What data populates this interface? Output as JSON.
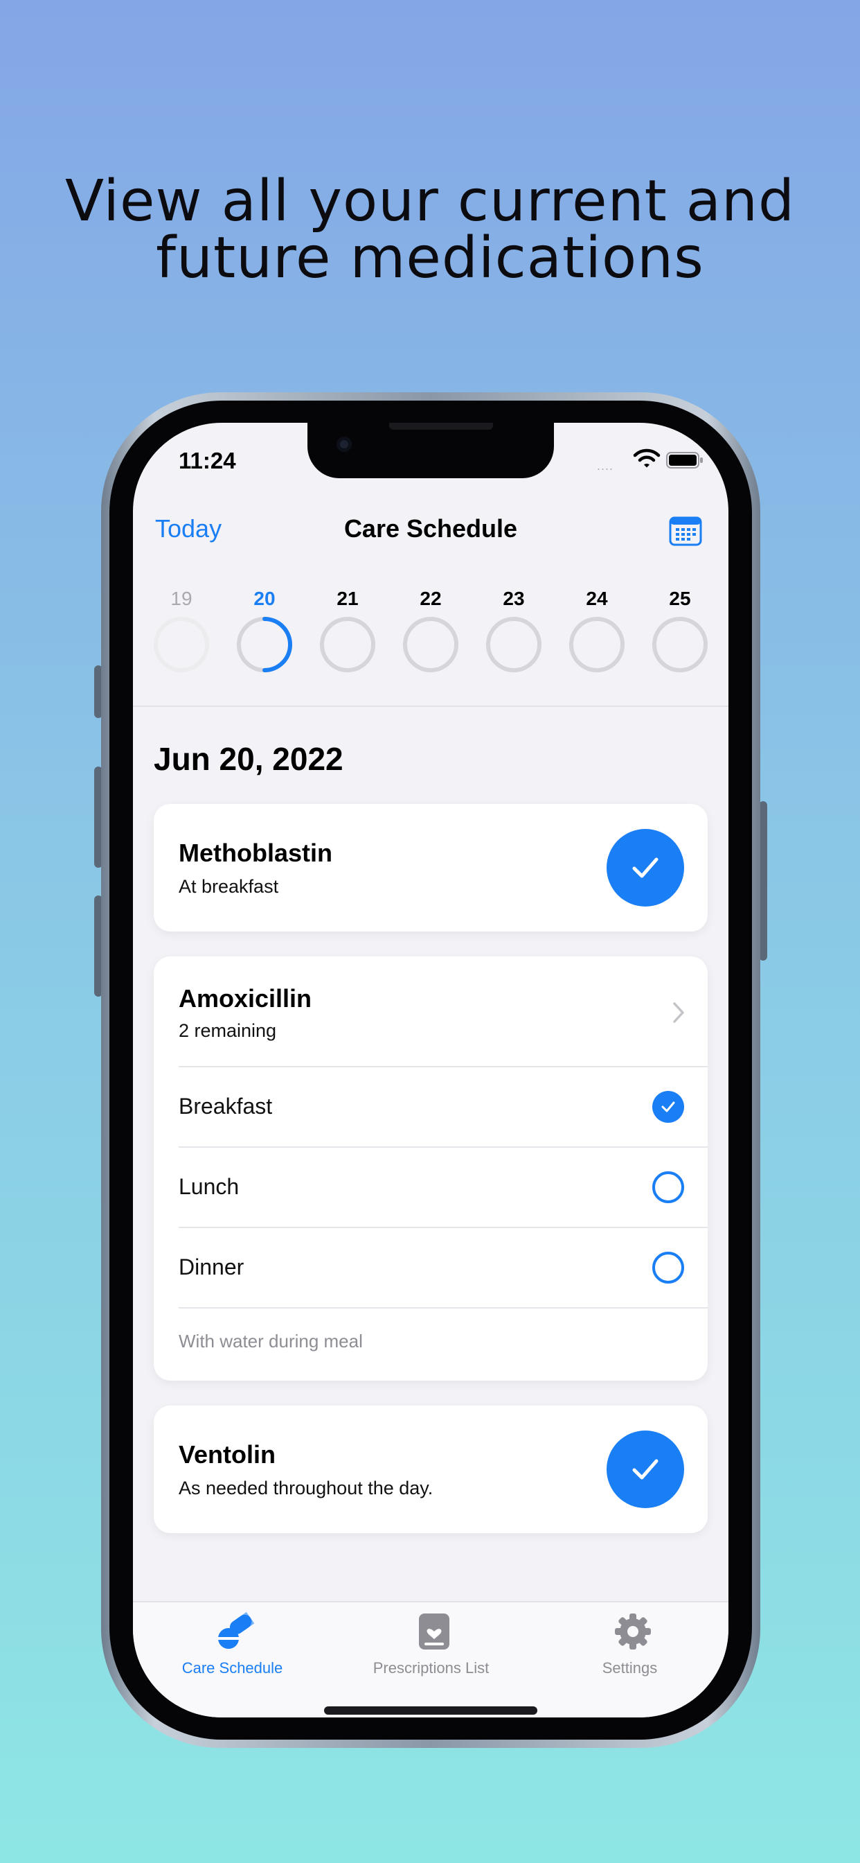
{
  "headline": {
    "line1": "View all your current and",
    "line2": "future medications"
  },
  "status_bar": {
    "time": "11:24",
    "signal_dots": "....",
    "icons": [
      "wifi-icon",
      "battery-icon"
    ]
  },
  "nav": {
    "today_label": "Today",
    "title": "Care Schedule",
    "calendar_icon": "calendar-icon"
  },
  "week": {
    "days": [
      {
        "num": "19",
        "state": "past",
        "progress": 0
      },
      {
        "num": "20",
        "state": "today",
        "progress": 0.42
      },
      {
        "num": "21",
        "state": "future",
        "progress": 0
      },
      {
        "num": "22",
        "state": "future",
        "progress": 0
      },
      {
        "num": "23",
        "state": "future",
        "progress": 0
      },
      {
        "num": "24",
        "state": "future",
        "progress": 0
      },
      {
        "num": "25",
        "state": "future",
        "progress": 0
      }
    ]
  },
  "date_heading": "Jun 20, 2022",
  "meds": {
    "methoblastin": {
      "name": "Methoblastin",
      "detail": "At breakfast",
      "done": true
    },
    "amoxicillin": {
      "name": "Amoxicillin",
      "detail": "2 remaining",
      "doses": [
        {
          "label": "Breakfast",
          "done": true
        },
        {
          "label": "Lunch",
          "done": false
        },
        {
          "label": "Dinner",
          "done": false
        }
      ],
      "note": "With water during meal"
    },
    "ventolin": {
      "name": "Ventolin",
      "detail": "As needed throughout the day.",
      "done": true
    }
  },
  "tabbar": {
    "tabs": [
      {
        "label": "Care Schedule",
        "icon": "pills-icon",
        "active": true
      },
      {
        "label": "Prescriptions List",
        "icon": "prescription-icon",
        "active": false
      },
      {
        "label": "Settings",
        "icon": "gear-icon",
        "active": false
      }
    ]
  },
  "colors": {
    "accent": "#1a7ef5",
    "background_top": "#84a6e6",
    "background_bottom": "#8ee6e4"
  }
}
